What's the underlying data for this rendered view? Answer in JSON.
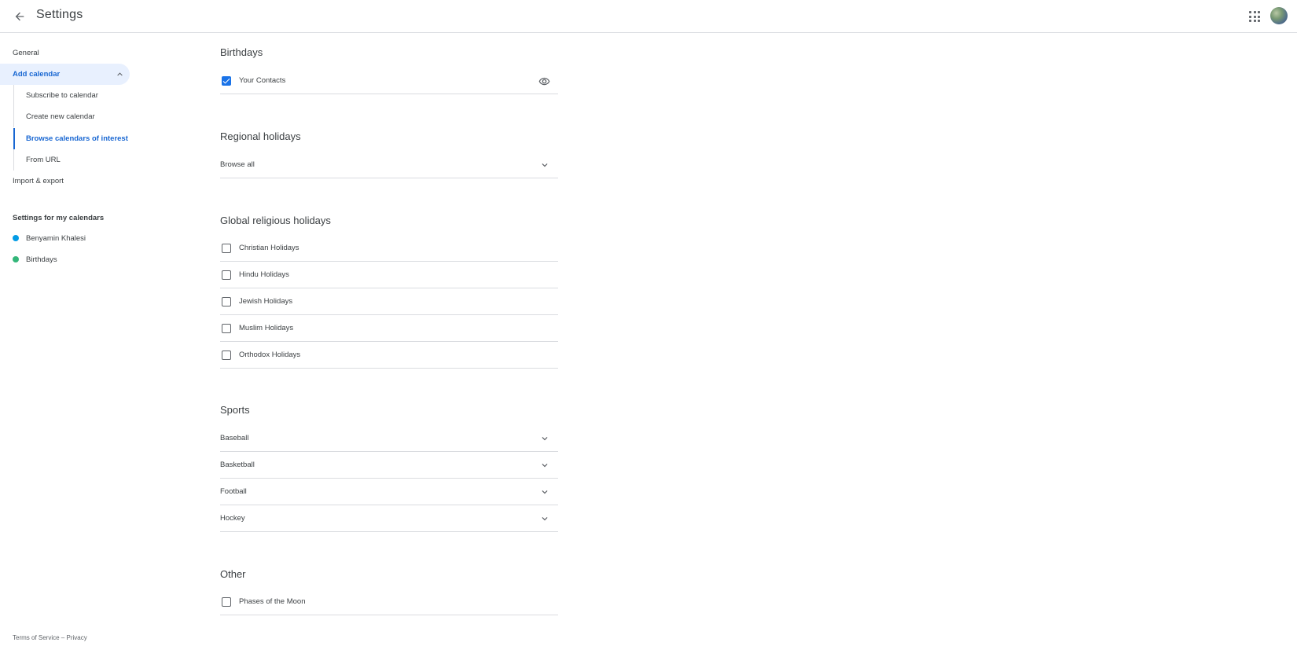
{
  "header": {
    "title": "Settings"
  },
  "sidebar": {
    "general": "General",
    "add_calendar": "Add calendar",
    "add_calendar_subitems": [
      "Subscribe to calendar",
      "Create new calendar",
      "Browse calendars of interest",
      "From URL"
    ],
    "import_export": "Import & export",
    "my_calendars_heading": "Settings for my calendars",
    "my_calendars": [
      {
        "name": "Benyamin Khalesi",
        "color": "#039be5"
      },
      {
        "name": "Birthdays",
        "color": "#33b679"
      }
    ]
  },
  "footer": {
    "terms": "Terms of Service",
    "separator": " – ",
    "privacy": "Privacy"
  },
  "sections": {
    "birthdays": {
      "title": "Birthdays",
      "items": [
        {
          "label": "Your Contacts",
          "checked": true
        }
      ]
    },
    "regional": {
      "title": "Regional holidays",
      "items": [
        "Browse all"
      ]
    },
    "religious": {
      "title": "Global religious holidays",
      "items": [
        {
          "label": "Christian Holidays",
          "checked": false
        },
        {
          "label": "Hindu Holidays",
          "checked": false
        },
        {
          "label": "Jewish Holidays",
          "checked": false
        },
        {
          "label": "Muslim Holidays",
          "checked": false
        },
        {
          "label": "Orthodox Holidays",
          "checked": false
        }
      ]
    },
    "sports": {
      "title": "Sports",
      "items": [
        "Baseball",
        "Basketball",
        "Football",
        "Hockey"
      ]
    },
    "other": {
      "title": "Other",
      "items": [
        {
          "label": "Phases of the Moon",
          "checked": false
        }
      ]
    }
  },
  "colors": {
    "accent": "#1967d2",
    "active_bg": "#e8f0fe",
    "checkbox_checked": "#1a73e8",
    "divider": "#dadce0"
  },
  "icons": {
    "back": "arrow-back-icon",
    "apps": "apps-grid-icon",
    "visibility": "eye-icon",
    "expand": "chevron-down-icon",
    "collapse": "chevron-up-icon"
  }
}
